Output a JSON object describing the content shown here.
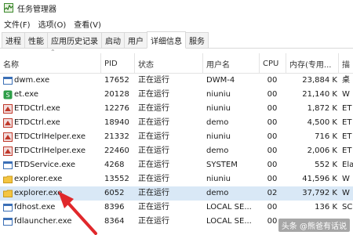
{
  "window": {
    "title": "任务管理器"
  },
  "menu": [
    "文件(F)",
    "选项(O)",
    "查看(V)"
  ],
  "tabs": [
    "进程",
    "性能",
    "应用历史记录",
    "启动",
    "用户",
    "详细信息",
    "服务"
  ],
  "active_tab": "详细信息",
  "columns": {
    "name": "名称",
    "pid": "PID",
    "status": "状态",
    "user": "用户名",
    "cpu": "CPU",
    "mem": "内存(专用...",
    "desc": "描"
  },
  "rows": [
    {
      "name": "dwm.exe",
      "pid": "17652",
      "status": "正在运行",
      "user": "DWM-4",
      "cpu": "00",
      "mem": "23,884 K",
      "desc": "桌",
      "icon": "window-icon"
    },
    {
      "name": "et.exe",
      "pid": "20128",
      "status": "正在运行",
      "user": "niuniu",
      "cpu": "00",
      "mem": "21,140 K",
      "desc": "W",
      "icon": "wps-sheet-icon"
    },
    {
      "name": "ETDCtrl.exe",
      "pid": "12276",
      "status": "正在运行",
      "user": "niuniu",
      "cpu": "00",
      "mem": "1,872 K",
      "desc": "ET",
      "icon": "etd-icon"
    },
    {
      "name": "ETDCtrl.exe",
      "pid": "18940",
      "status": "正在运行",
      "user": "demo",
      "cpu": "00",
      "mem": "4,500 K",
      "desc": "ET",
      "icon": "etd-icon"
    },
    {
      "name": "ETDCtrlHelper.exe",
      "pid": "21332",
      "status": "正在运行",
      "user": "niuniu",
      "cpu": "00",
      "mem": "716 K",
      "desc": "ET",
      "icon": "etd-icon"
    },
    {
      "name": "ETDCtrlHelper.exe",
      "pid": "22460",
      "status": "正在运行",
      "user": "demo",
      "cpu": "00",
      "mem": "2,006 K",
      "desc": "ET",
      "icon": "etd-icon"
    },
    {
      "name": "ETDService.exe",
      "pid": "4268",
      "status": "正在运行",
      "user": "SYSTEM",
      "cpu": "00",
      "mem": "552 K",
      "desc": "Ela",
      "icon": "window-icon"
    },
    {
      "name": "explorer.exe",
      "pid": "13552",
      "status": "正在运行",
      "user": "niuniu",
      "cpu": "00",
      "mem": "41,596 K",
      "desc": "W",
      "icon": "folder-icon"
    },
    {
      "name": "explorer.exe",
      "pid": "6052",
      "status": "正在运行",
      "user": "demo",
      "cpu": "02",
      "mem": "37,792 K",
      "desc": "W",
      "icon": "folder-icon",
      "selected": true
    },
    {
      "name": "fdhost.exe",
      "pid": "8396",
      "status": "正在运行",
      "user": "LOCAL SE...",
      "cpu": "00",
      "mem": "136 K",
      "desc": "SC",
      "icon": "window-icon"
    },
    {
      "name": "fdlauncher.exe",
      "pid": "8364",
      "status": "正在运行",
      "user": "LOCAL SE...",
      "cpu": "00",
      "mem": "",
      "desc": "",
      "icon": "window-icon"
    }
  ],
  "watermark": "头条 @熊爸有话说",
  "colors": {
    "selected_row": "#d9e8f6",
    "arrow": "#e0282b"
  }
}
